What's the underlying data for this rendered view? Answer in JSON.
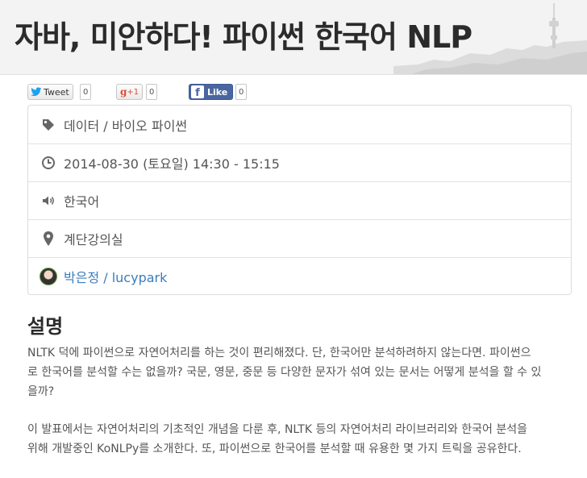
{
  "header": {
    "title": "자바, 미안하다! 파이썬 한국어 NLP"
  },
  "social": {
    "tweet_label": "Tweet",
    "tweet_count": "0",
    "gplus_label": "+1",
    "gplus_count": "0",
    "fb_label": "Like",
    "fb_count": "0"
  },
  "info": {
    "category": "데이터 / 바이오 파이썬",
    "datetime": "2014-08-30 (토요일) 14:30 - 15:15",
    "language": "한국어",
    "room": "계단강의실",
    "speaker": "박은정 / lucypark"
  },
  "description": {
    "title": "설명",
    "line1": "NLTK 덕에 파이썬으로 자연어처리를 하는 것이 편리해졌다. 단, 한국어만 분석하려하지 않는다면. 파이썬으",
    "line2": "로 한국어를 분석할 수는 없을까? 국문, 영문, 중문 등 다양한 문자가 섞여 있는 문서는 어떻게 분석을 할 수 있",
    "line3": "을까?",
    "line4": "이 발표에서는 자연어처리의 기초적인 개념을 다룬 후, NLTK 등의 자연어처리 라이브러리와 한국어 분석을",
    "line5": "위해 개발중인 KoNLPy를 소개한다. 또, 파이썬으로 한국어를 분석할 때 유용한 몇 가지 트릭을 공유한다."
  },
  "colors": {
    "link": "#3a7dbb",
    "facebook": "#4a66a0",
    "twitter": "#1da1f2",
    "gplus": "#dd4b39"
  }
}
